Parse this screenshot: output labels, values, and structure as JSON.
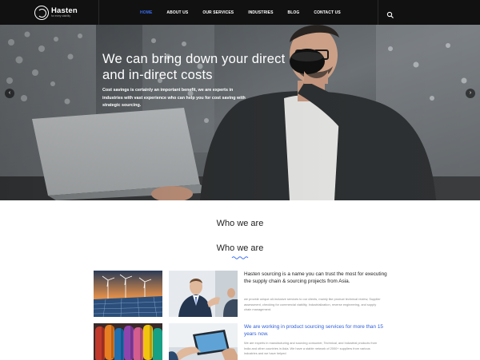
{
  "brand": {
    "name": "Hasten",
    "tagline": "for every stability"
  },
  "nav": {
    "items": [
      {
        "label": "HOME",
        "active": true
      },
      {
        "label": "ABOUT US",
        "active": false
      },
      {
        "label": "OUR SERVICES",
        "active": false
      },
      {
        "label": "INDUSTRIES",
        "active": false
      },
      {
        "label": "BLOG",
        "active": false
      },
      {
        "label": "CONTACT US",
        "active": false
      }
    ],
    "search_icon": "search-icon"
  },
  "hero": {
    "title": "We can bring down your direct and in-direct costs",
    "text": "Cost savings is certainly an important benefit, we are experts in industries with vast experience who can help you for cost saving with strategic sourcing.",
    "prev_arrow": "‹",
    "next_arrow": "›"
  },
  "content": {
    "heading_1": "Who we are",
    "heading_2": "Who we are",
    "about_title": "Hasten sourcing is a name you can trust the most for executing the supply chain & sourcing projects from Asia.",
    "about_body": "we provide unique all-inclusive services to our clients, mainly like product technical review, Supplier assessment, checking for commercial viability, Industrialization, reverse engineering, and supply chain management.",
    "highlight": "We are working in product sourcing services for more than 15 years now.",
    "about_body_2": "We are experts in manufacturing and sourcing consumer, Technical, and Industrial products from India and other countries in Asia. We have a stable network of 2000+ suppliers from various industries and we have helped"
  },
  "colors": {
    "accent": "#3a6df0",
    "header_bg": "#111111",
    "highlight_text": "#2e5ed8"
  }
}
